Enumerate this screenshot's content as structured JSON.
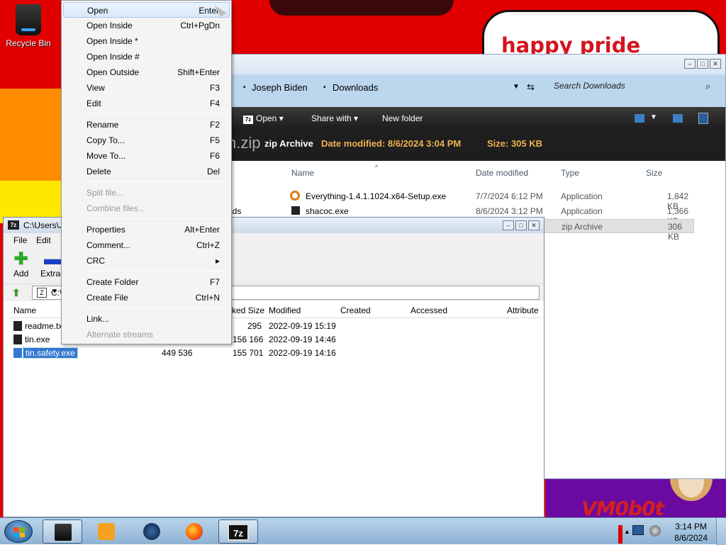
{
  "desktop": {
    "recycle_bin_label": "Recycle Bin",
    "wallpaper_text": "happy pride month",
    "wallpaper_logo_text": "VM0b0t"
  },
  "explorer": {
    "breadcrumbs": [
      "Joseph Biden",
      "Downloads"
    ],
    "search_placeholder": "Search Downloads",
    "toolbar": {
      "open": "Open",
      "share_with": "Share with",
      "new_folder": "New folder"
    },
    "details": {
      "filename_fragment": "n.zip",
      "type": "zip Archive",
      "date_modified": "Date modified: 8/6/2024 3:04 PM",
      "size": "Size: 305 KB"
    },
    "columns": {
      "name": "Name",
      "date_modified": "Date modified",
      "type": "Type",
      "size": "Size"
    },
    "rows": [
      {
        "name": "Everything-1.4.1.1024.x64-Setup.exe",
        "date": "7/7/2024 6:12 PM",
        "type": "Application",
        "size": "1,842 KB"
      },
      {
        "name": "shacoc.exe",
        "date": "8/6/2024 3:12 PM",
        "type": "Application",
        "size": "1,366 KB"
      },
      {
        "name": "",
        "date": "",
        "type": "zip Archive",
        "size": "306 KB"
      }
    ],
    "nav_fragment": "ads"
  },
  "sevenzip": {
    "title": "C:\\Users\\J",
    "title_icon": "7z",
    "menu": {
      "file": "File",
      "edit": "Edit"
    },
    "tools": {
      "add": "Add",
      "extract": "Extrac"
    },
    "path": "C:\\",
    "columns": {
      "name": "Name",
      "packed_size": "ked Size",
      "modified": "Modified",
      "created": "Created",
      "accessed": "Accessed",
      "attributes": "Attribute"
    },
    "rows": [
      {
        "name": "readme.txt",
        "size": "",
        "packed": "295",
        "modified": "2022-09-19 15:19"
      },
      {
        "name": "tin.exe",
        "size": "",
        "packed": "156 166",
        "modified": "2022-09-19 14:46"
      },
      {
        "name": "tin.safety.exe",
        "size": "449 536",
        "packed": "155 701",
        "modified": "2022-09-19 14:16"
      }
    ]
  },
  "context_menu": {
    "items": [
      {
        "label": "Open",
        "shortcut": "Enter"
      },
      {
        "label": "Open Inside",
        "shortcut": "Ctrl+PgDn"
      },
      {
        "label": "Open Inside *",
        "shortcut": ""
      },
      {
        "label": "Open Inside #",
        "shortcut": ""
      },
      {
        "label": "Open Outside",
        "shortcut": "Shift+Enter"
      },
      {
        "label": "View",
        "shortcut": "F3"
      },
      {
        "label": "Edit",
        "shortcut": "F4"
      },
      {
        "label": "Rename",
        "shortcut": "F2"
      },
      {
        "label": "Copy To...",
        "shortcut": "F5"
      },
      {
        "label": "Move To...",
        "shortcut": "F6"
      },
      {
        "label": "Delete",
        "shortcut": "Del"
      },
      {
        "label": "Split file...",
        "shortcut": ""
      },
      {
        "label": "Combine files...",
        "shortcut": ""
      },
      {
        "label": "Properties",
        "shortcut": "Alt+Enter"
      },
      {
        "label": "Comment...",
        "shortcut": "Ctrl+Z"
      },
      {
        "label": "CRC",
        "shortcut": "▸"
      },
      {
        "label": "Create Folder",
        "shortcut": "F7"
      },
      {
        "label": "Create File",
        "shortcut": "Ctrl+N"
      },
      {
        "label": "Link...",
        "shortcut": ""
      },
      {
        "label": "Alternate streams",
        "shortcut": ""
      }
    ]
  },
  "taskbar": {
    "time": "3:14 PM",
    "date": "8/6/2024",
    "active_task_label": "7z"
  },
  "colors": {
    "wallpaper_red": "#e00000",
    "explorer_dark_toolbar": "#1e1e1e",
    "details_accent": "#f0b050",
    "selection_blue": "#3278d2",
    "taskbar": "#a7c2dc"
  }
}
